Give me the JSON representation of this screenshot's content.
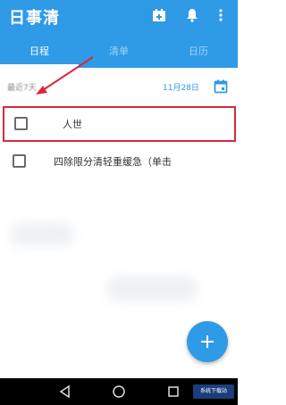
{
  "app": {
    "title": "日事清"
  },
  "tabs": [
    {
      "label": "日程"
    },
    {
      "label": "清单"
    },
    {
      "label": "日历"
    }
  ],
  "header_icons": [
    "calendar-add-icon",
    "bell-icon",
    "more-vertical-icon"
  ],
  "date_row": {
    "left_text": "最近7天",
    "right_text": "11月28日"
  },
  "todos": [
    {
      "text": "人世",
      "checked": false
    },
    {
      "text": "四除限分清轻重缓急（单击",
      "checked": false
    }
  ],
  "annotation": {
    "arrow_color": "#d9283a",
    "highlight_color": "#d9283a"
  },
  "fab": {
    "label": "+"
  },
  "nav_icons": [
    "back-icon",
    "home-icon",
    "recents-icon"
  ],
  "watermark": {
    "text": "系统下载站"
  },
  "colors": {
    "primary": "#2f9ae6",
    "nav_bar": "#000000"
  }
}
